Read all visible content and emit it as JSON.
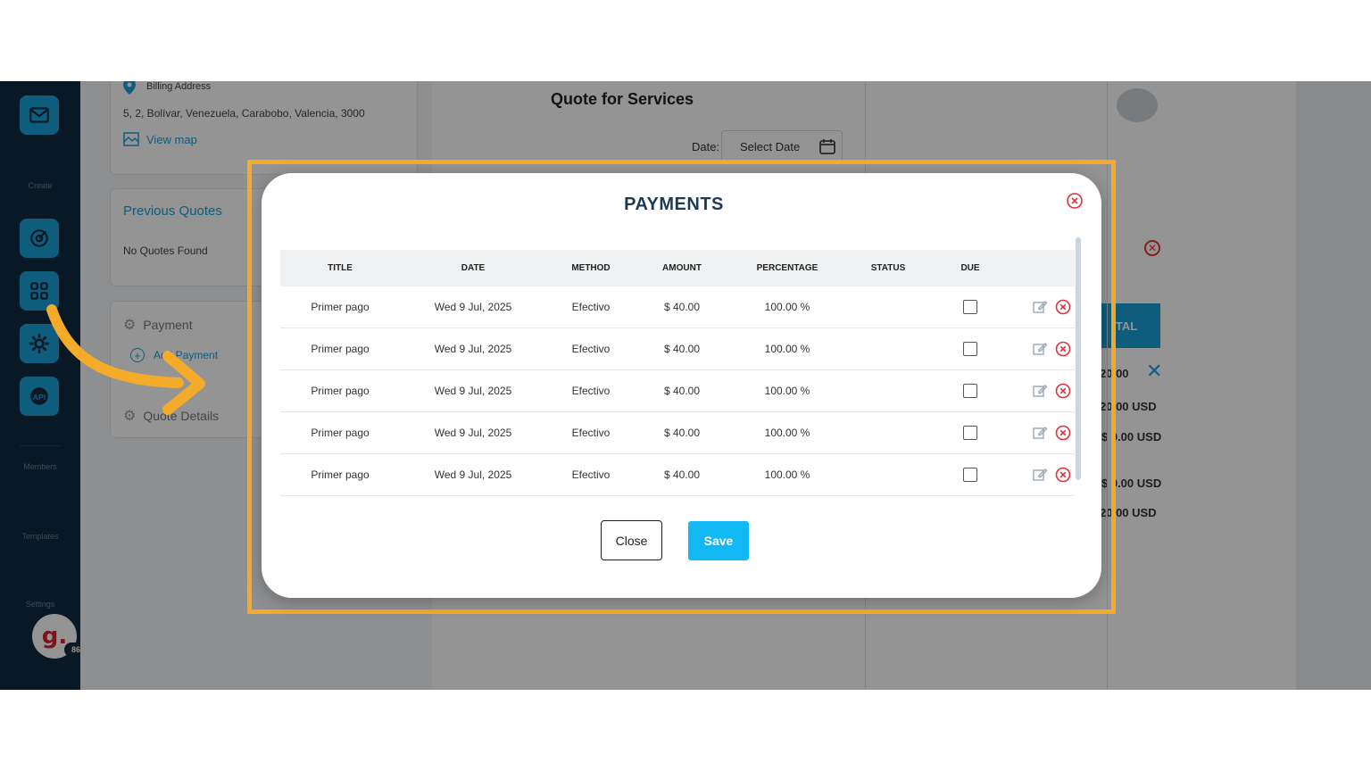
{
  "nav": {
    "labels": {
      "create": "Create",
      "members": "Members",
      "templates": "Templates",
      "settings": "Settings"
    },
    "avatar_letter": "g.",
    "avatar_badge": "86",
    "icons": [
      "mail-icon",
      "target-icon",
      "grid-icon",
      "settings-gear-icon",
      "api-icon"
    ]
  },
  "background": {
    "billing_label": "Billing Address",
    "billing_address": "5, 2, Bolívar, Venezuela, Carabobo, Valencia, 3000",
    "view_map": "View map",
    "previous_quotes": "Previous Quotes",
    "no_quotes": "No Quotes Found",
    "payment_label": "Payment",
    "add_payment": "Add Payment",
    "quote_details": "Quote Details",
    "quote_title": "Quote for Services",
    "date_label": "Date:",
    "date_placeholder": "Select Date",
    "total_fragment": "TAL",
    "amount_fragments": [
      "20.00",
      "20.00 USD",
      "$ 0.00 USD",
      "$ 0.00 USD",
      "20.00 USD"
    ]
  },
  "modal": {
    "title": "PAYMENTS",
    "columns": [
      "TITLE",
      "DATE",
      "METHOD",
      "AMOUNT",
      "PERCENTAGE",
      "STATUS",
      "DUE"
    ],
    "rows": [
      {
        "title": "Primer pago",
        "date": "Wed 9 Jul, 2025",
        "method": "Efectivo",
        "amount": "$ 40.00",
        "percentage": "100.00 %",
        "status": "",
        "due": false
      },
      {
        "title": "Primer pago",
        "date": "Wed 9 Jul, 2025",
        "method": "Efectivo",
        "amount": "$ 40.00",
        "percentage": "100.00 %",
        "status": "",
        "due": false
      },
      {
        "title": "Primer pago",
        "date": "Wed 9 Jul, 2025",
        "method": "Efectivo",
        "amount": "$ 40.00",
        "percentage": "100.00 %",
        "status": "",
        "due": false
      },
      {
        "title": "Primer pago",
        "date": "Wed 9 Jul, 2025",
        "method": "Efectivo",
        "amount": "$ 40.00",
        "percentage": "100.00 %",
        "status": "",
        "due": false
      },
      {
        "title": "Primer pago",
        "date": "Wed 9 Jul, 2025",
        "method": "Efectivo",
        "amount": "$ 40.00",
        "percentage": "100.00 %",
        "status": "",
        "due": false
      }
    ],
    "close_label": "Close",
    "save_label": "Save"
  },
  "colors": {
    "highlight": "#f5ab2a",
    "accent": "#12b8f4",
    "nav_bg": "#0f2a3f",
    "delete": "#e0323c"
  }
}
